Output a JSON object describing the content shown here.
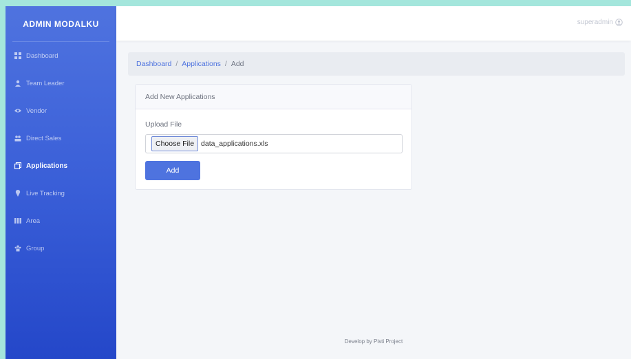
{
  "sidebar": {
    "brand": "ADMIN MODALKU",
    "items": [
      {
        "label": "Dashboard",
        "icon": "dashboard-icon",
        "active": false
      },
      {
        "label": "Team Leader",
        "icon": "person-icon",
        "active": false
      },
      {
        "label": "Vendor",
        "icon": "eye-icon",
        "active": false
      },
      {
        "label": "Direct Sales",
        "icon": "users-icon",
        "active": false
      },
      {
        "label": "Applications",
        "icon": "copy-icon",
        "active": true
      },
      {
        "label": "Live Tracking",
        "icon": "pin-icon",
        "active": false
      },
      {
        "label": "Area",
        "icon": "grid-icon",
        "active": false
      },
      {
        "label": "Group",
        "icon": "group-icon",
        "active": false
      }
    ]
  },
  "topbar": {
    "user": "superadmin"
  },
  "breadcrumb": {
    "home": "Dashboard",
    "section": "Applications",
    "current": "Add",
    "separator": "/"
  },
  "card": {
    "title": "Add New Applications",
    "upload_label": "Upload File",
    "choose_label": "Choose File",
    "file_name": "data_applications.xls",
    "submit_label": "Add"
  },
  "footer": {
    "text": "Develop by Pisti Project"
  },
  "colors": {
    "primary": "#4e73df",
    "background_outer": "#a4e6dc",
    "content_bg": "#f4f6f9"
  }
}
